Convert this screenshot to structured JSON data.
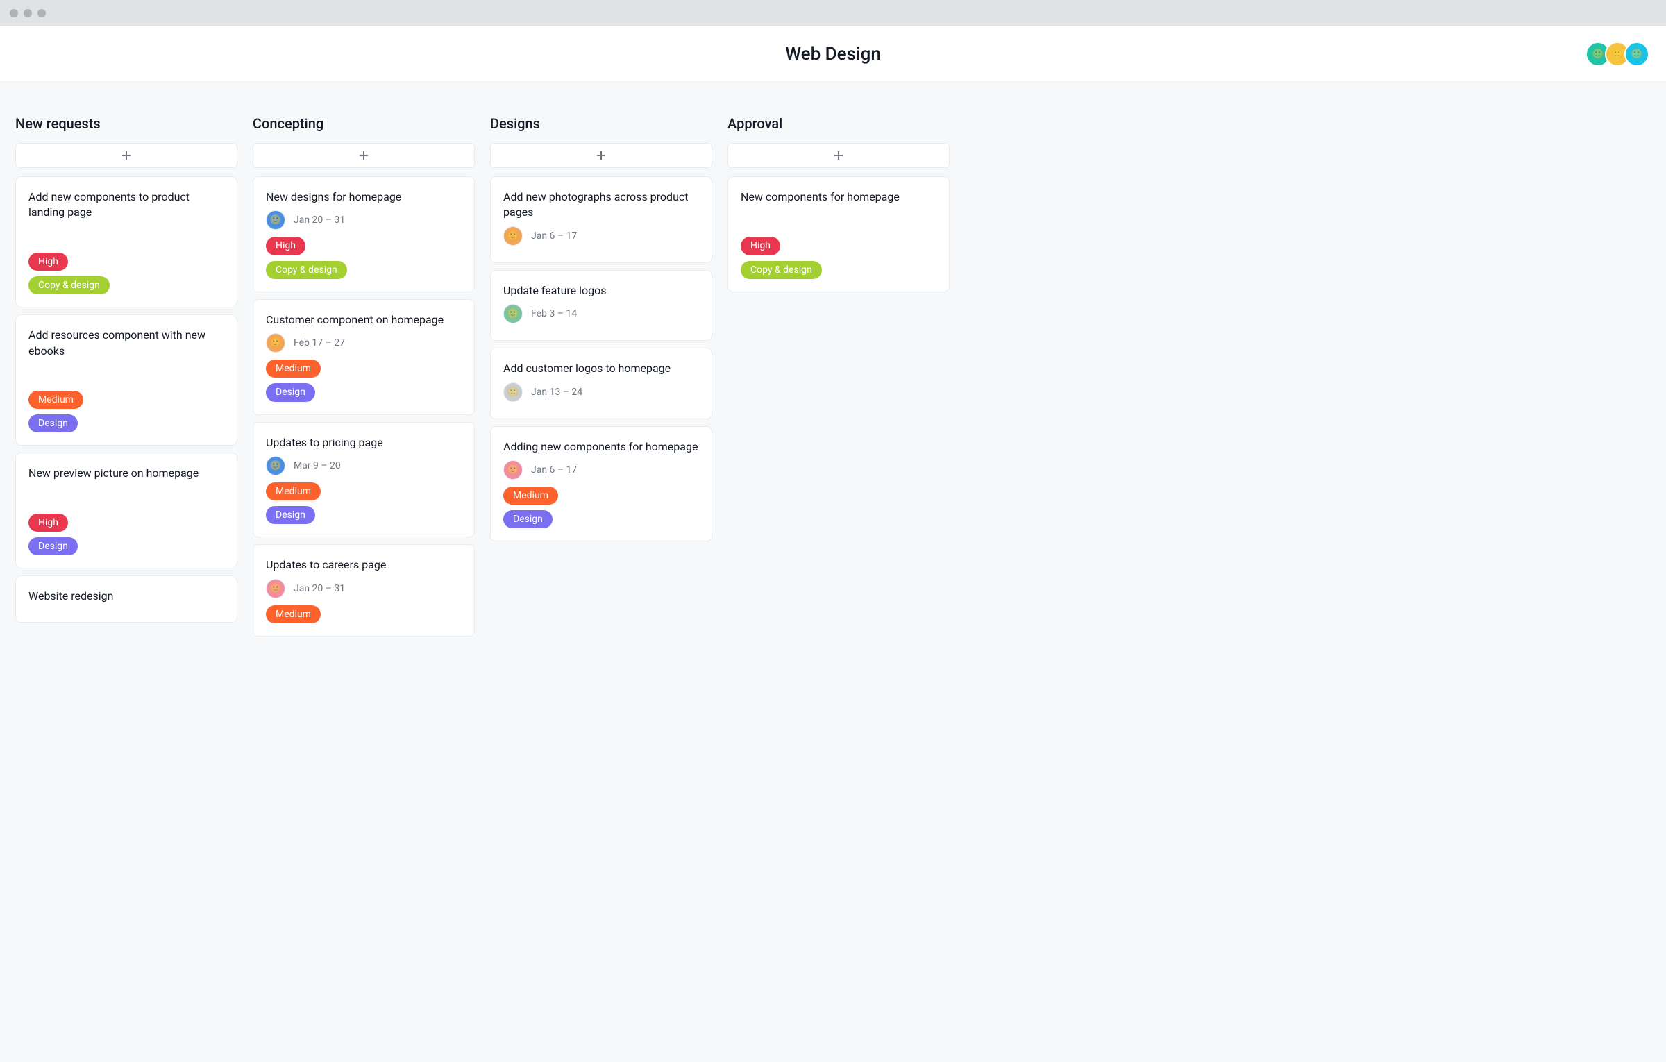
{
  "header": {
    "title": "Web Design"
  },
  "avatars": [
    {
      "name": "member-1",
      "color_class": "av-teal"
    },
    {
      "name": "member-2",
      "color_class": "av-yellow"
    },
    {
      "name": "member-3",
      "color_class": "av-cyan"
    }
  ],
  "tag_colors": {
    "High": "#e8384f",
    "Medium": "#fd612c",
    "Copy & design": "#a4cf30",
    "Design": "#7a6ff0"
  },
  "assignee_colors": {
    "blue": "av-blue",
    "orange": "av-orange",
    "pink": "av-pink",
    "green": "av-green",
    "gray": "av-gray"
  },
  "columns": [
    {
      "title": "New requests",
      "cards": [
        {
          "title": "Add new components to product landing page",
          "spacer": true,
          "tags": [
            "High",
            "Copy & design"
          ]
        },
        {
          "title": "Add resources component with new ebooks",
          "spacer": true,
          "tags": [
            "Medium",
            "Design"
          ]
        },
        {
          "title": "New preview picture on homepage",
          "spacer": true,
          "tags": [
            "High",
            "Design"
          ]
        },
        {
          "title": "Website redesign"
        }
      ]
    },
    {
      "title": "Concepting",
      "cards": [
        {
          "title": "New designs for homepage",
          "assignee": "blue",
          "date": "Jan 20 – 31",
          "tags": [
            "High",
            "Copy & design"
          ]
        },
        {
          "title": "Customer component on homepage",
          "assignee": "orange",
          "date": "Feb 17 – 27",
          "tags": [
            "Medium",
            "Design"
          ]
        },
        {
          "title": "Updates to pricing page",
          "assignee": "blue",
          "date": "Mar 9 – 20",
          "tags": [
            "Medium",
            "Design"
          ]
        },
        {
          "title": "Updates to careers page",
          "assignee": "pink",
          "date": "Jan 20 – 31",
          "tags": [
            "Medium"
          ]
        }
      ]
    },
    {
      "title": "Designs",
      "cards": [
        {
          "title": "Add new photographs across product pages",
          "assignee": "orange",
          "date": "Jan 6 – 17"
        },
        {
          "title": "Update feature logos",
          "assignee": "green",
          "date": "Feb 3 – 14"
        },
        {
          "title": "Add customer logos to homepage",
          "assignee": "gray",
          "date": "Jan 13 – 24"
        },
        {
          "title": "Adding new components for homepage",
          "assignee": "pink",
          "date": "Jan 6 – 17",
          "tags": [
            "Medium",
            "Design"
          ]
        }
      ]
    },
    {
      "title": "Approval",
      "cards": [
        {
          "title": "New components for homepage",
          "spacer": true,
          "tags": [
            "High",
            "Copy & design"
          ]
        }
      ]
    }
  ]
}
